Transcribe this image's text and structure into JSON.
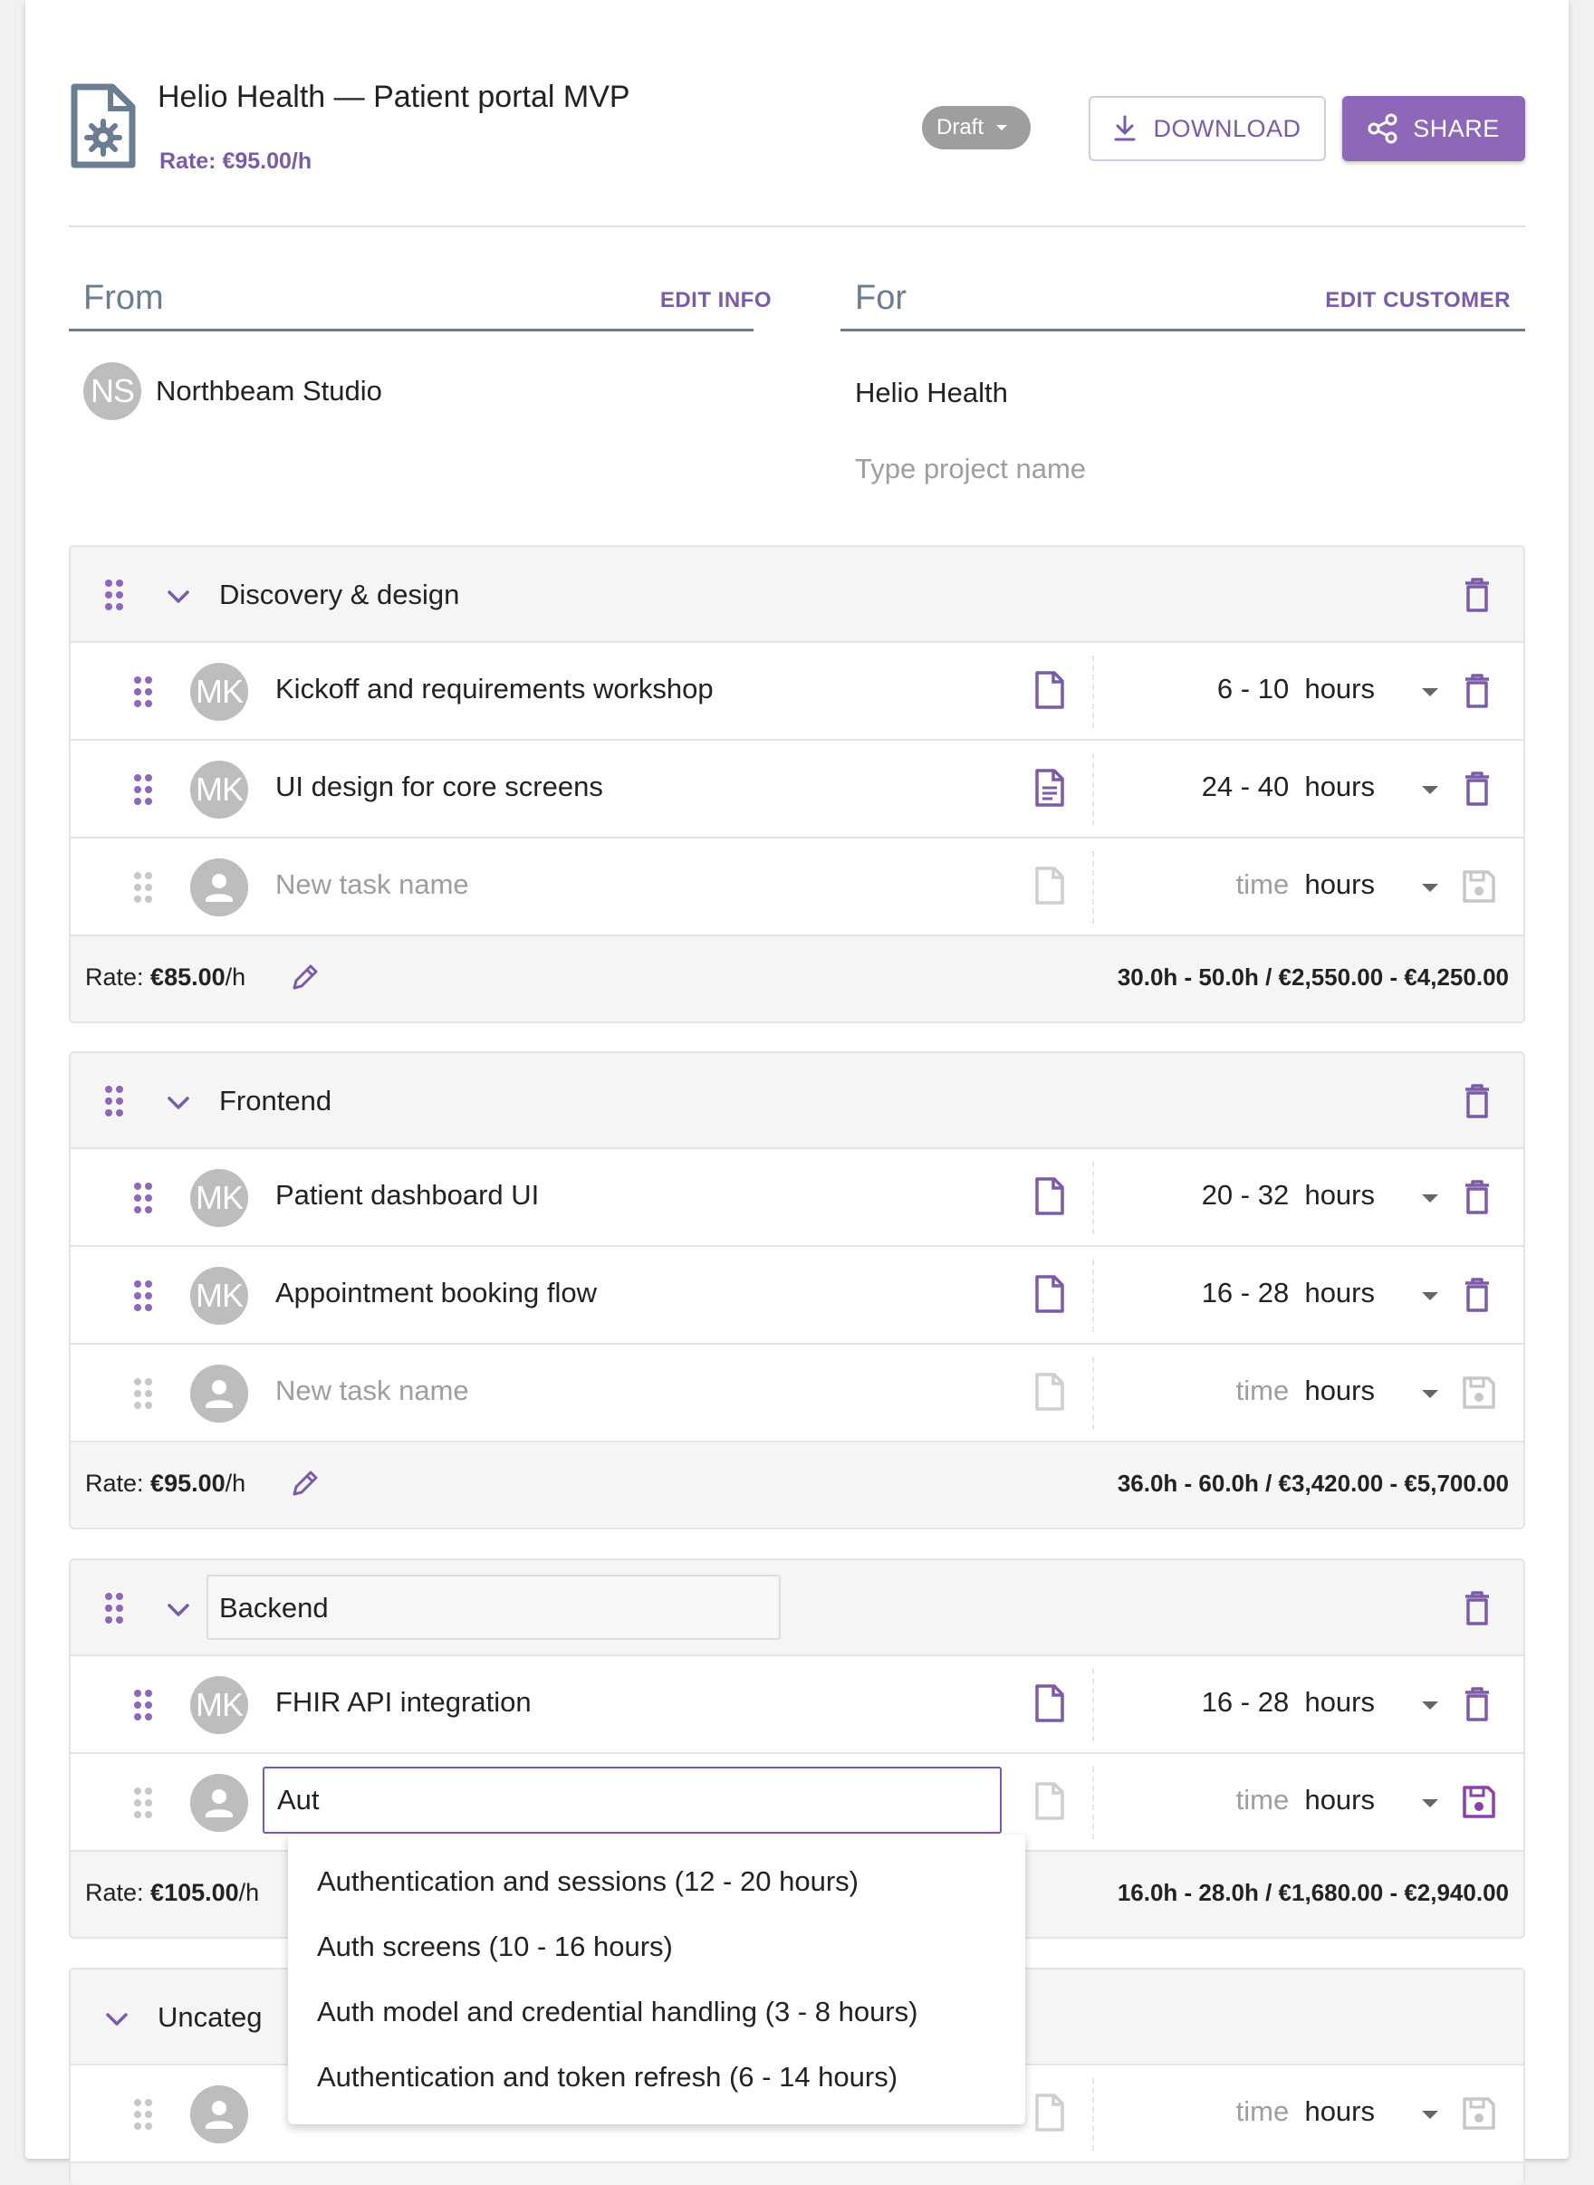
{
  "header": {
    "title": "Helio Health — Patient portal MVP",
    "rate": "Rate: €95.00/h",
    "status": "Draft",
    "download_label": "DOWNLOAD",
    "share_label": "SHARE"
  },
  "from": {
    "label": "From",
    "edit_label": "EDIT INFO",
    "avatar_initials": "NS",
    "name": "Northbeam Studio"
  },
  "for": {
    "label": "For",
    "edit_label": "EDIT CUSTOMER",
    "customer": "Helio Health",
    "project_placeholder": "Type project name"
  },
  "groups": [
    {
      "name": "Discovery & design",
      "tasks": [
        {
          "avatar": "MK",
          "name": "Kickoff and requirements workshop",
          "min": "6",
          "max": "10",
          "unit": "hours",
          "has_note": false
        },
        {
          "avatar": "MK",
          "name": "UI design for core screens",
          "min": "24",
          "max": "40",
          "unit": "hours",
          "has_note": true
        }
      ],
      "new_task_placeholder": "New task name",
      "new_time_placeholder": "time",
      "new_unit": "hours",
      "rate_prefix": "Rate: ",
      "rate_value": "€85.00",
      "rate_suffix": "/h",
      "total": "30.0h - 50.0h / €2,550.00 - €4,250.00"
    },
    {
      "name": "Frontend",
      "tasks": [
        {
          "avatar": "MK",
          "name": "Patient dashboard UI",
          "min": "20",
          "max": "32",
          "unit": "hours",
          "has_note": false
        },
        {
          "avatar": "MK",
          "name": "Appointment booking flow",
          "min": "16",
          "max": "28",
          "unit": "hours",
          "has_note": false
        }
      ],
      "new_task_placeholder": "New task name",
      "new_time_placeholder": "time",
      "new_unit": "hours",
      "rate_prefix": "Rate: ",
      "rate_value": "€95.00",
      "rate_suffix": "/h",
      "total": "36.0h - 60.0h / €3,420.00 - €5,700.00"
    },
    {
      "name": "Backend",
      "tasks": [
        {
          "avatar": "MK",
          "name": "FHIR API integration",
          "min": "16",
          "max": "28",
          "unit": "hours",
          "has_note": false
        }
      ],
      "new_task_value": "Aut",
      "new_time_placeholder": "time",
      "new_unit": "hours",
      "rate_prefix": "Rate: ",
      "rate_value": "€105.00",
      "rate_suffix": "/h",
      "total": "16.0h - 28.0h / €1,680.00 - €2,940.00"
    },
    {
      "name": "Uncateg",
      "new_time_placeholder": "time",
      "new_unit": "hours"
    }
  ],
  "autocomplete": [
    "Authentication and sessions  (12 - 20 hours)",
    "Auth screens  (10 - 16 hours)",
    "Auth model and credential handling  (3 - 8 hours)",
    "Authentication and token refresh  (6 - 14 hours)"
  ],
  "colors": {
    "accent": "#8e67b8",
    "accent_text": "#7b5ba8",
    "slate": "#6a7d93",
    "avatar_gray": "#bdbdbd",
    "chip_gray": "#9e9e9e"
  },
  "icons": {
    "document": "document-gear-icon",
    "download": "download-icon",
    "share": "share-icon",
    "grip": "drag-handle-icon",
    "chevron": "chevron-down-icon",
    "trash": "trash-icon",
    "note": "note-icon",
    "save": "save-icon",
    "pencil": "pencil-icon",
    "person": "person-icon"
  }
}
